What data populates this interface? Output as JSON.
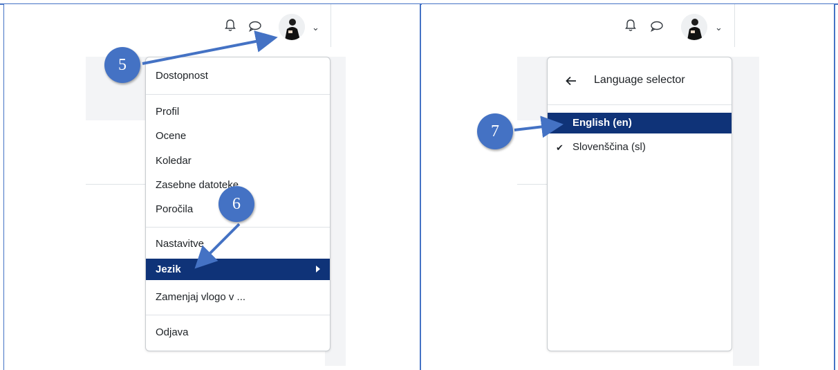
{
  "left": {
    "menu_items": [
      {
        "label": "Dostopnost"
      },
      {
        "label": "Profil"
      },
      {
        "label": "Ocene"
      },
      {
        "label": "Koledar"
      },
      {
        "label": "Zasebne datoteke"
      },
      {
        "label": "Poročila"
      },
      {
        "label": "Nastavitve"
      },
      {
        "label": "Jezik"
      },
      {
        "label": "Zamenjaj vlogo v ..."
      },
      {
        "label": "Odjava"
      }
    ],
    "active_item": "Jezik",
    "step_badges": [
      "5",
      "6"
    ]
  },
  "right": {
    "header_title": "Language selector",
    "languages": [
      {
        "label": "English (en)",
        "selected": false,
        "highlighted": true
      },
      {
        "label": "Slovenščina (sl)",
        "selected": true,
        "highlighted": false
      }
    ],
    "step_badge": "7"
  },
  "icons": {
    "bell": "bell-icon",
    "chat": "chat-bubble-icon",
    "avatar": "user-avatar",
    "chevron": "chevron-down-icon",
    "back": "arrow-left-icon",
    "check": "check-icon",
    "submenu": "caret-right-icon"
  },
  "colors": {
    "frame": "#4472c4",
    "badge": "#4472c4",
    "highlight": "#0f3378",
    "arrow": "#4472c4"
  }
}
